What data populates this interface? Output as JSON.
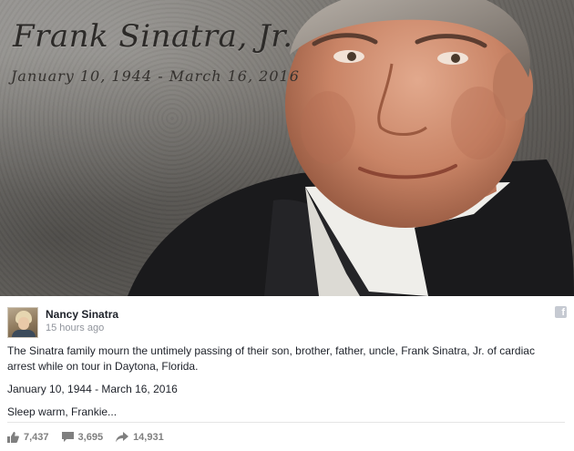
{
  "hero": {
    "memorial_name": "Frank Sinatra, Jr.",
    "memorial_dates": "January 10, 1944 - March 16, 2016"
  },
  "post": {
    "author": "Nancy Sinatra",
    "timestamp": "15 hours ago",
    "paragraphs": [
      "The Sinatra family mourn the untimely passing of their son, brother, father, uncle, Frank Sinatra, Jr. of cardiac arrest while on tour in Daytona, Florida.",
      "January 10, 1944 - March 16, 2016",
      "Sleep warm, Frankie..."
    ],
    "badge_icon": "facebook-f-icon",
    "badge_glyph": "f"
  },
  "stats": {
    "likes": "7,437",
    "comments": "3,695",
    "shares": "14,931",
    "icons": [
      "thumbs-up-icon",
      "comment-icon",
      "share-arrow-icon"
    ]
  },
  "colors": {
    "stat_icon": "#7f7f7f",
    "meta_text": "#90949c"
  }
}
